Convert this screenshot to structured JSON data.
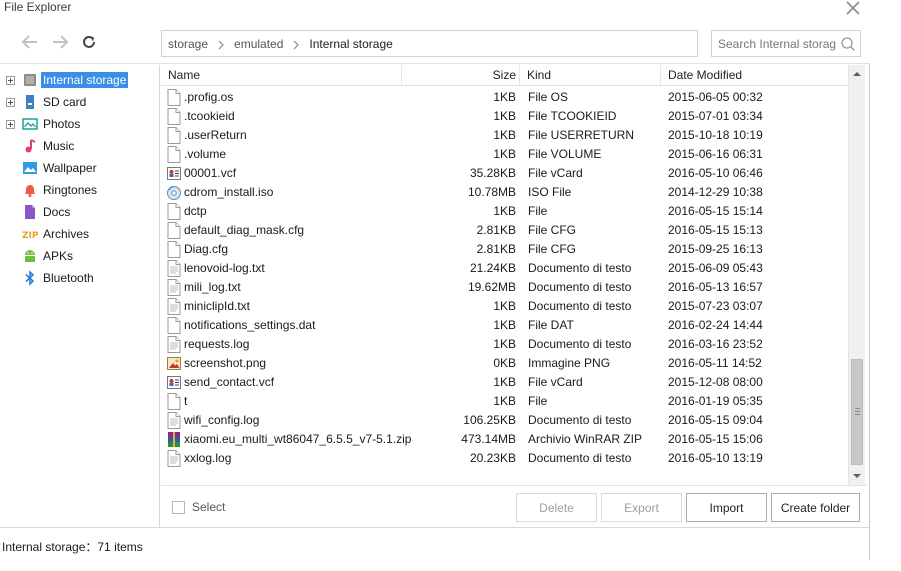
{
  "window": {
    "title": "File Explorer"
  },
  "toolbar": {
    "breadcrumb": [
      "storage",
      "emulated",
      "Internal storage"
    ],
    "search_placeholder": "Search  Internal storag"
  },
  "sidebar": {
    "items": [
      {
        "label": "Internal storage",
        "icon": "storage-icon",
        "expandable": true,
        "selected": true
      },
      {
        "label": "SD card",
        "icon": "sd-card-icon",
        "expandable": true
      },
      {
        "label": "Photos",
        "icon": "photos-icon",
        "expandable": true
      },
      {
        "label": "Music",
        "icon": "music-icon"
      },
      {
        "label": "Wallpaper",
        "icon": "wallpaper-icon"
      },
      {
        "label": "Ringtones",
        "icon": "bell-icon"
      },
      {
        "label": "Docs",
        "icon": "docs-icon"
      },
      {
        "label": "Archives",
        "icon": "zip-icon"
      },
      {
        "label": "APKs",
        "icon": "android-icon"
      },
      {
        "label": "Bluetooth",
        "icon": "bluetooth-icon"
      }
    ]
  },
  "list": {
    "headers": {
      "name": "Name",
      "size": "Size",
      "kind": "Kind",
      "date": "Date Modified"
    },
    "rows": [
      {
        "name": ".profig.os",
        "size": "1KB",
        "kind": "File OS",
        "date": "2015-06-05 00:32",
        "icon": "file-icon"
      },
      {
        "name": ".tcookieid",
        "size": "1KB",
        "kind": "File TCOOKIEID",
        "date": "2015-07-01 03:34",
        "icon": "file-icon"
      },
      {
        "name": ".userReturn",
        "size": "1KB",
        "kind": "File USERRETURN",
        "date": "2015-10-18 10:19",
        "icon": "file-icon"
      },
      {
        "name": ".volume",
        "size": "1KB",
        "kind": "File VOLUME",
        "date": "2015-06-16 06:31",
        "icon": "file-icon"
      },
      {
        "name": "00001.vcf",
        "size": "35.28KB",
        "kind": "File vCard",
        "date": "2016-05-10 06:46",
        "icon": "vcard-icon"
      },
      {
        "name": "cdrom_install.iso",
        "size": "10.78MB",
        "kind": "ISO File",
        "date": "2014-12-29 10:38",
        "icon": "disc-icon"
      },
      {
        "name": "dctp",
        "size": "1KB",
        "kind": "File",
        "date": "2016-05-15 15:14",
        "icon": "file-icon"
      },
      {
        "name": "default_diag_mask.cfg",
        "size": "2.81KB",
        "kind": "File CFG",
        "date": "2016-05-15 15:13",
        "icon": "file-icon"
      },
      {
        "name": "Diag.cfg",
        "size": "2.81KB",
        "kind": "File CFG",
        "date": "2015-09-25 16:13",
        "icon": "file-icon"
      },
      {
        "name": "lenovoid-log.txt",
        "size": "21.24KB",
        "kind": "Documento di testo",
        "date": "2015-06-09 05:43",
        "icon": "text-file-icon"
      },
      {
        "name": "mili_log.txt",
        "size": "19.62MB",
        "kind": "Documento di testo",
        "date": "2016-05-13 16:57",
        "icon": "text-file-icon"
      },
      {
        "name": "miniclipId.txt",
        "size": "1KB",
        "kind": "Documento di testo",
        "date": "2015-07-23 03:07",
        "icon": "text-file-icon"
      },
      {
        "name": "notifications_settings.dat",
        "size": "1KB",
        "kind": "File DAT",
        "date": "2016-02-24 14:44",
        "icon": "file-icon"
      },
      {
        "name": "requests.log",
        "size": "1KB",
        "kind": "Documento di testo",
        "date": "2016-03-16 23:52",
        "icon": "text-file-icon"
      },
      {
        "name": "screenshot.png",
        "size": "0KB",
        "kind": "Immagine PNG",
        "date": "2016-05-11 14:52",
        "icon": "image-file-icon"
      },
      {
        "name": "send_contact.vcf",
        "size": "1KB",
        "kind": "File vCard",
        "date": "2015-12-08 08:00",
        "icon": "vcard-icon"
      },
      {
        "name": "t",
        "size": "1KB",
        "kind": "File",
        "date": "2016-01-19 05:35",
        "icon": "file-icon"
      },
      {
        "name": "wifi_config.log",
        "size": "106.25KB",
        "kind": "Documento di testo",
        "date": "2016-05-15 09:04",
        "icon": "text-file-icon"
      },
      {
        "name": "xiaomi.eu_multi_wt86047_6.5.5_v7-5.1.zip",
        "size": "473.14MB",
        "kind": "Archivio WinRAR ZIP",
        "date": "2016-05-15 15:06",
        "icon": "winrar-icon"
      },
      {
        "name": "xxlog.log",
        "size": "20.23KB",
        "kind": "Documento di testo",
        "date": "2016-05-10 13:19",
        "icon": "text-file-icon"
      }
    ]
  },
  "actions": {
    "select_label": "Select",
    "delete_label": "Delete",
    "export_label": "Export",
    "import_label": "Import",
    "create_folder_label": "Create folder"
  },
  "status": {
    "text": "Internal  storage：71 items"
  },
  "colors": {
    "selection": "#3a8ee6"
  }
}
